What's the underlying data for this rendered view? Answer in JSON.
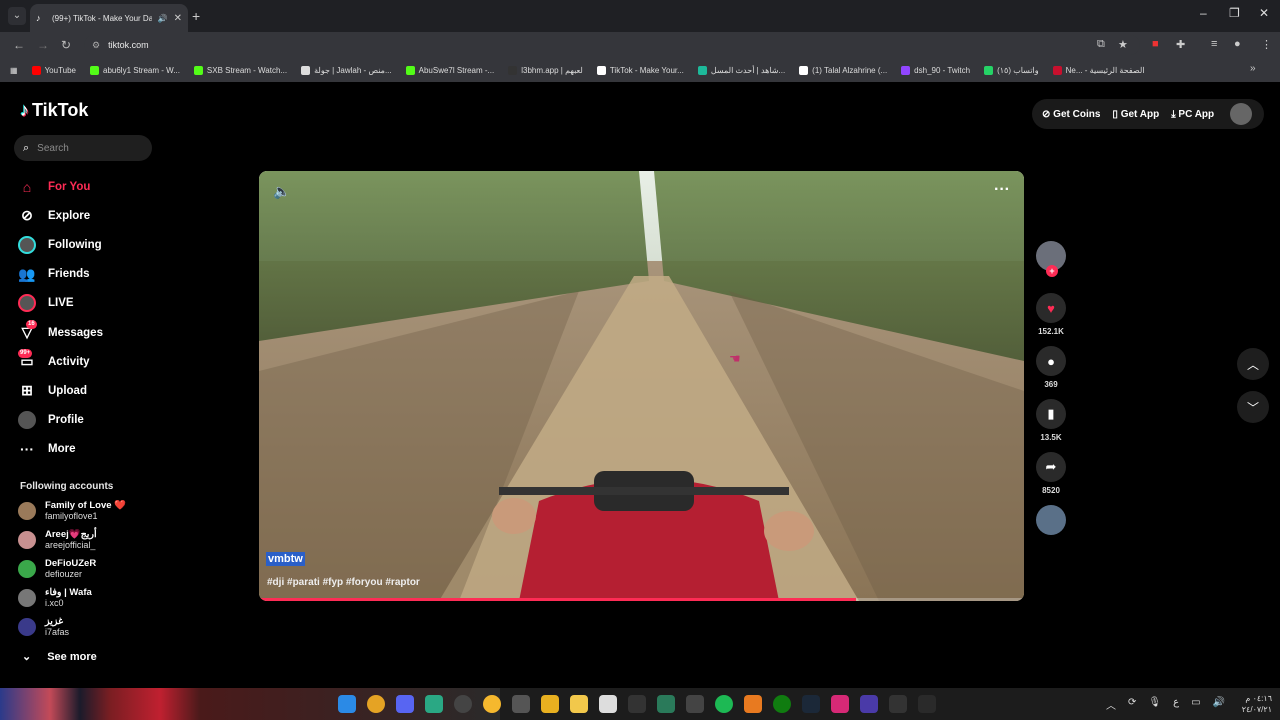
{
  "browser": {
    "tab_title": "(99+) TikTok - Make Your Day",
    "url": "tiktok.com",
    "bookmarks": [
      {
        "label": "YouTube",
        "color": "#ff0000"
      },
      {
        "label": "abu6ly1 Stream - W...",
        "color": "#53fc18"
      },
      {
        "label": "SXB Stream - Watch...",
        "color": "#53fc18"
      },
      {
        "label": "جولة | Jawlah - منص...",
        "color": "#dddddd"
      },
      {
        "label": "AbuSwe7l Stream -...",
        "color": "#53fc18"
      },
      {
        "label": "l3bhm.app | لعبهم",
        "color": "#333333"
      },
      {
        "label": "TikTok - Make Your...",
        "color": "#ffffff"
      },
      {
        "label": "شاهد | أحدث المسل...",
        "color": "#1db99a"
      },
      {
        "label": "(1) Talal Alzahrine (...",
        "color": "#ffffff"
      },
      {
        "label": "dsh_90 - Twitch",
        "color": "#9146ff"
      },
      {
        "label": "واتساب (۱٥)",
        "color": "#25d366"
      },
      {
        "label": "Ne... - الصفحة الرئيسية",
        "color": "#c8102e"
      }
    ]
  },
  "tiktok": {
    "brand": "TikTok",
    "search_placeholder": "Search",
    "nav": [
      {
        "label": "For You",
        "icon": "home-icon"
      },
      {
        "label": "Explore",
        "icon": "compass-icon"
      },
      {
        "label": "Following",
        "icon": "following-icon"
      },
      {
        "label": "Friends",
        "icon": "friends-icon"
      },
      {
        "label": "LIVE",
        "icon": "live-icon"
      },
      {
        "label": "Messages",
        "icon": "messages-icon",
        "badge": "16"
      },
      {
        "label": "Activity",
        "icon": "activity-icon",
        "badge": "99+"
      },
      {
        "label": "Upload",
        "icon": "upload-icon"
      },
      {
        "label": "Profile",
        "icon": "profile-icon"
      },
      {
        "label": "More",
        "icon": "more-icon"
      }
    ],
    "following_title": "Following accounts",
    "accounts": [
      {
        "name": "Family of Love ❤️",
        "user": "familyoflove1",
        "color": "#9a7a5a"
      },
      {
        "name": "Areej💗أريج",
        "user": "areejofficial_",
        "color": "#c89090"
      },
      {
        "name": "DeFioUZeR",
        "user": "defiouzer",
        "color": "#3aa84a"
      },
      {
        "name": "وفاء | Wafa",
        "user": "i.xc0",
        "color": "#777777"
      },
      {
        "name": "غزيز",
        "user": "i7afas",
        "color": "#3a3a8a"
      }
    ],
    "see_more": "See more",
    "top_actions": {
      "coins": "Get Coins",
      "app": "Get App",
      "pc": "PC App"
    },
    "video": {
      "author": "vmbtw",
      "hashtags": "#dji #parati #fyp #foryou #raptor",
      "progress": 0.78
    },
    "stats": {
      "likes": "152.1K",
      "comments": "369",
      "saves": "13.5K",
      "shares": "8520"
    }
  },
  "taskbar": {
    "clock_time": "٠٤:١٦ م",
    "clock_date": "٢٤/٠٧/٢١",
    "lang": "ع"
  }
}
